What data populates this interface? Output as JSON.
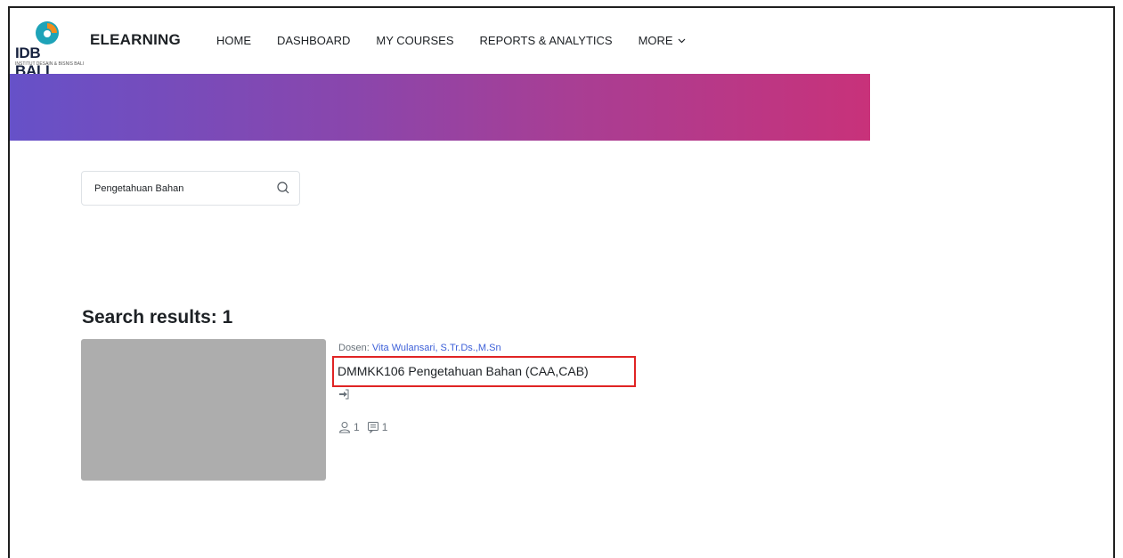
{
  "logo": {
    "text": "IDB BALI",
    "subtext": "INSTITUT DESAIN & BISNIS BALI",
    "mark_color": "#1ea3b8",
    "accent_color": "#f28c1e"
  },
  "brand": "ELEARNING",
  "nav": {
    "items": [
      {
        "label": "HOME"
      },
      {
        "label": "DASHBOARD"
      },
      {
        "label": "MY COURSES"
      },
      {
        "label": "REPORTS & ANALYTICS"
      },
      {
        "label": "MORE",
        "icon": "chevron-down-icon"
      }
    ]
  },
  "hero": {
    "gradient_start": "#6651c8",
    "gradient_end": "#c8327a"
  },
  "search": {
    "value": "Pengetahuan Bahan",
    "icon": "search-icon"
  },
  "results": {
    "heading": "Search results: 1",
    "courses": [
      {
        "teacher_prefix": "Dosen:",
        "teacher_name": "Vita Wulansari, S.Tr.Ds.,M.Sn",
        "name": "DMMKK106 Pengetahuan Bahan (CAA,CAB)",
        "enrol_icon": "sign-in-icon",
        "participants": "1",
        "forum_posts": "1",
        "highlight_color": "#e02424"
      }
    ]
  }
}
